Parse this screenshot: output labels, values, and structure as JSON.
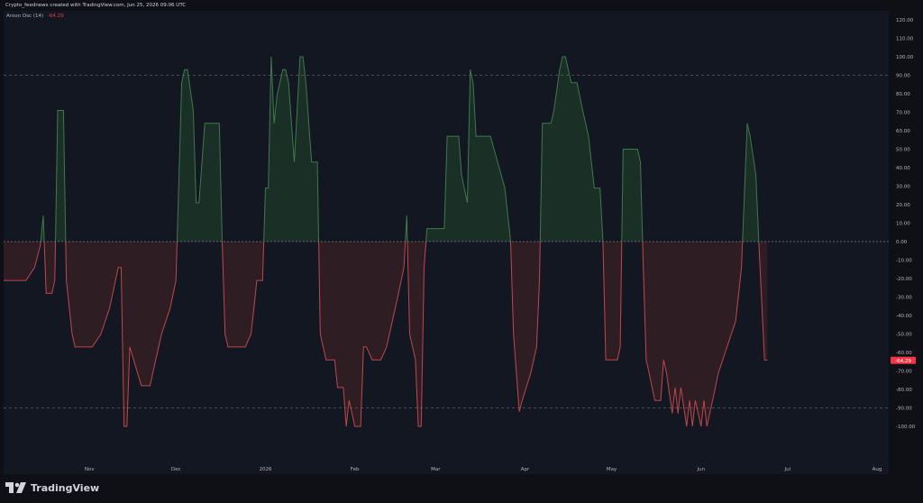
{
  "header": {
    "attribution": "Crypto_feednews created with TradingView.com, Jun 25, 2026 09:06 UTC"
  },
  "legend": {
    "name": "Aroon Osc (14)",
    "value": "-64.29"
  },
  "brand": {
    "name": "TradingView",
    "icon": "tradingview-logo-icon"
  },
  "colors": {
    "background": "#131722",
    "frame": "#0e1015",
    "positive_line": "#3e7a4a",
    "negative_line": "#c0474c",
    "positive_fill": "#1a3026",
    "negative_fill": "#2e1d23",
    "last_value_badge": "#f23645",
    "axis_text": "#b2b5be"
  },
  "chart_data": {
    "type": "area",
    "title": "",
    "indicator": "Aroon Osc (14)",
    "last_value": -64.29,
    "last_value_label": "-64.29",
    "ylim": [
      -110,
      120
    ],
    "yticks": [
      -100,
      -90,
      -80,
      -70,
      -60,
      -50,
      -40,
      -30,
      -20,
      -10,
      0,
      10,
      20,
      30,
      40,
      50,
      60,
      70,
      80,
      90,
      100,
      110,
      120
    ],
    "ytick_labels": [
      "-100.00",
      "-90.00",
      "-80.00",
      "-70.00",
      "-60.00",
      "-50.00",
      "-40.00",
      "-30.00",
      "-20.00",
      "-10.00",
      "0.00",
      "10.00",
      "20.00",
      "30.00",
      "40.00",
      "50.00",
      "60.00",
      "70.00",
      "80.00",
      "90.00",
      "100.00",
      "110.00",
      "120.00"
    ],
    "reference_lines": [
      90,
      -90
    ],
    "grid": false,
    "x_axis_labels": [
      {
        "label": "Nov",
        "date": "2025-11-01"
      },
      {
        "label": "Dec",
        "date": "2025-12-01"
      },
      {
        "label": "2026",
        "date": "2026-01-01"
      },
      {
        "label": "Feb",
        "date": "2026-02-01"
      },
      {
        "label": "Mar",
        "date": "2026-03-01"
      },
      {
        "label": "Apr",
        "date": "2026-04-01"
      },
      {
        "label": "May",
        "date": "2026-05-01"
      },
      {
        "label": "Jun",
        "date": "2026-06-01"
      },
      {
        "label": "Jul",
        "date": "2026-07-01"
      },
      {
        "label": "Aug",
        "date": "2026-08-01"
      }
    ],
    "series": [
      {
        "points": [
          [
            "2025-10-02",
            -21
          ],
          [
            "2025-10-10",
            -21
          ],
          [
            "2025-10-13",
            -14
          ],
          [
            "2025-10-15",
            -2
          ],
          [
            "2025-10-16",
            14
          ],
          [
            "2025-10-17",
            -28
          ],
          [
            "2025-10-19",
            -28
          ],
          [
            "2025-10-20",
            -21
          ],
          [
            "2025-10-21",
            71
          ],
          [
            "2025-10-23",
            71
          ],
          [
            "2025-10-24",
            -21
          ],
          [
            "2025-10-26",
            -50
          ],
          [
            "2025-10-27",
            -57
          ],
          [
            "2025-11-02",
            -57
          ],
          [
            "2025-11-05",
            -50
          ],
          [
            "2025-11-08",
            -36
          ],
          [
            "2025-11-11",
            -14
          ],
          [
            "2025-11-12",
            -14
          ],
          [
            "2025-11-13",
            -100
          ],
          [
            "2025-11-14",
            -100
          ],
          [
            "2025-11-15",
            -57
          ],
          [
            "2025-11-19",
            -78
          ],
          [
            "2025-11-22",
            -78
          ],
          [
            "2025-11-26",
            -50
          ],
          [
            "2025-11-29",
            -36
          ],
          [
            "2025-12-01",
            -21
          ],
          [
            "2025-12-03",
            86
          ],
          [
            "2025-12-04",
            93
          ],
          [
            "2025-12-05",
            93
          ],
          [
            "2025-12-07",
            71
          ],
          [
            "2025-12-08",
            21
          ],
          [
            "2025-12-09",
            21
          ],
          [
            "2025-12-11",
            64
          ],
          [
            "2025-12-12",
            64
          ],
          [
            "2025-12-16",
            64
          ],
          [
            "2025-12-17",
            0
          ],
          [
            "2025-12-18",
            -50
          ],
          [
            "2025-12-19",
            -57
          ],
          [
            "2025-12-25",
            -57
          ],
          [
            "2025-12-27",
            -50
          ],
          [
            "2025-12-28",
            -36
          ],
          [
            "2025-12-29",
            -21
          ],
          [
            "2025-12-31",
            -21
          ],
          [
            "2026-01-01",
            29
          ],
          [
            "2026-01-02",
            29
          ],
          [
            "2026-01-03",
            100
          ],
          [
            "2026-01-04",
            64
          ],
          [
            "2026-01-05",
            79
          ],
          [
            "2026-01-07",
            93
          ],
          [
            "2026-01-08",
            93
          ],
          [
            "2026-01-09",
            86
          ],
          [
            "2026-01-11",
            43
          ],
          [
            "2026-01-13",
            100
          ],
          [
            "2026-01-14",
            100
          ],
          [
            "2026-01-15",
            86
          ],
          [
            "2026-01-17",
            43
          ],
          [
            "2026-01-19",
            43
          ],
          [
            "2026-01-20",
            -50
          ],
          [
            "2026-01-22",
            -64
          ],
          [
            "2026-01-24",
            -64
          ],
          [
            "2026-01-25",
            -64
          ],
          [
            "2026-01-26",
            -79
          ],
          [
            "2026-01-28",
            -79
          ],
          [
            "2026-01-29",
            -100
          ],
          [
            "2026-01-30",
            -86
          ],
          [
            "2026-02-01",
            -100
          ],
          [
            "2026-02-02",
            -100
          ],
          [
            "2026-02-03",
            -100
          ],
          [
            "2026-02-04",
            -57
          ],
          [
            "2026-02-05",
            -57
          ],
          [
            "2026-02-07",
            -64
          ],
          [
            "2026-02-10",
            -64
          ],
          [
            "2026-02-12",
            -57
          ],
          [
            "2026-02-14",
            -43
          ],
          [
            "2026-02-16",
            -29
          ],
          [
            "2026-02-18",
            -14
          ],
          [
            "2026-02-19",
            14
          ],
          [
            "2026-02-20",
            -50
          ],
          [
            "2026-02-22",
            -64
          ],
          [
            "2026-02-23",
            -100
          ],
          [
            "2026-02-24",
            -100
          ],
          [
            "2026-02-25",
            -14
          ],
          [
            "2026-02-26",
            7
          ],
          [
            "2026-03-01",
            7
          ],
          [
            "2026-03-04",
            7
          ],
          [
            "2026-03-05",
            57
          ],
          [
            "2026-03-09",
            57
          ],
          [
            "2026-03-10",
            36
          ],
          [
            "2026-03-12",
            21
          ],
          [
            "2026-03-13",
            93
          ],
          [
            "2026-03-14",
            86
          ],
          [
            "2026-03-15",
            57
          ],
          [
            "2026-03-20",
            57
          ],
          [
            "2026-03-25",
            29
          ],
          [
            "2026-03-27",
            0
          ],
          [
            "2026-03-28",
            -50
          ],
          [
            "2026-03-30",
            -92
          ],
          [
            "2026-03-31",
            -86
          ],
          [
            "2026-04-03",
            -71
          ],
          [
            "2026-04-05",
            -57
          ],
          [
            "2026-04-06",
            -21
          ],
          [
            "2026-04-07",
            64
          ],
          [
            "2026-04-10",
            64
          ],
          [
            "2026-04-11",
            71
          ],
          [
            "2026-04-13",
            93
          ],
          [
            "2026-04-14",
            100
          ],
          [
            "2026-04-15",
            100
          ],
          [
            "2026-04-17",
            86
          ],
          [
            "2026-04-19",
            86
          ],
          [
            "2026-04-21",
            71
          ],
          [
            "2026-04-23",
            57
          ],
          [
            "2026-04-25",
            29
          ],
          [
            "2026-04-27",
            29
          ],
          [
            "2026-04-28",
            0
          ],
          [
            "2026-04-29",
            -64
          ],
          [
            "2026-05-02",
            -64
          ],
          [
            "2026-05-03",
            -64
          ],
          [
            "2026-05-04",
            -57
          ],
          [
            "2026-05-05",
            50
          ],
          [
            "2026-05-10",
            50
          ],
          [
            "2026-05-11",
            43
          ],
          [
            "2026-05-12",
            -14
          ],
          [
            "2026-05-13",
            -64
          ],
          [
            "2026-05-14",
            -71
          ],
          [
            "2026-05-16",
            -86
          ],
          [
            "2026-05-18",
            -86
          ],
          [
            "2026-05-19",
            -64
          ],
          [
            "2026-05-20",
            -71
          ],
          [
            "2026-05-22",
            -93
          ],
          [
            "2026-05-23",
            -79
          ],
          [
            "2026-05-24",
            -93
          ],
          [
            "2026-05-25",
            -79
          ],
          [
            "2026-05-27",
            -100
          ],
          [
            "2026-05-28",
            -86
          ],
          [
            "2026-05-29",
            -100
          ],
          [
            "2026-05-30",
            -86
          ],
          [
            "2026-06-01",
            -100
          ],
          [
            "2026-06-02",
            -86
          ],
          [
            "2026-06-03",
            -100
          ],
          [
            "2026-06-04",
            -93
          ],
          [
            "2026-06-05",
            -86
          ],
          [
            "2026-06-07",
            -71
          ],
          [
            "2026-06-10",
            -57
          ],
          [
            "2026-06-13",
            -43
          ],
          [
            "2026-06-15",
            -14
          ],
          [
            "2026-06-17",
            64
          ],
          [
            "2026-06-18",
            57
          ],
          [
            "2026-06-20",
            36
          ],
          [
            "2026-06-21",
            0
          ],
          [
            "2026-06-23",
            -64
          ],
          [
            "2026-06-24",
            -64.29
          ]
        ]
      }
    ]
  }
}
